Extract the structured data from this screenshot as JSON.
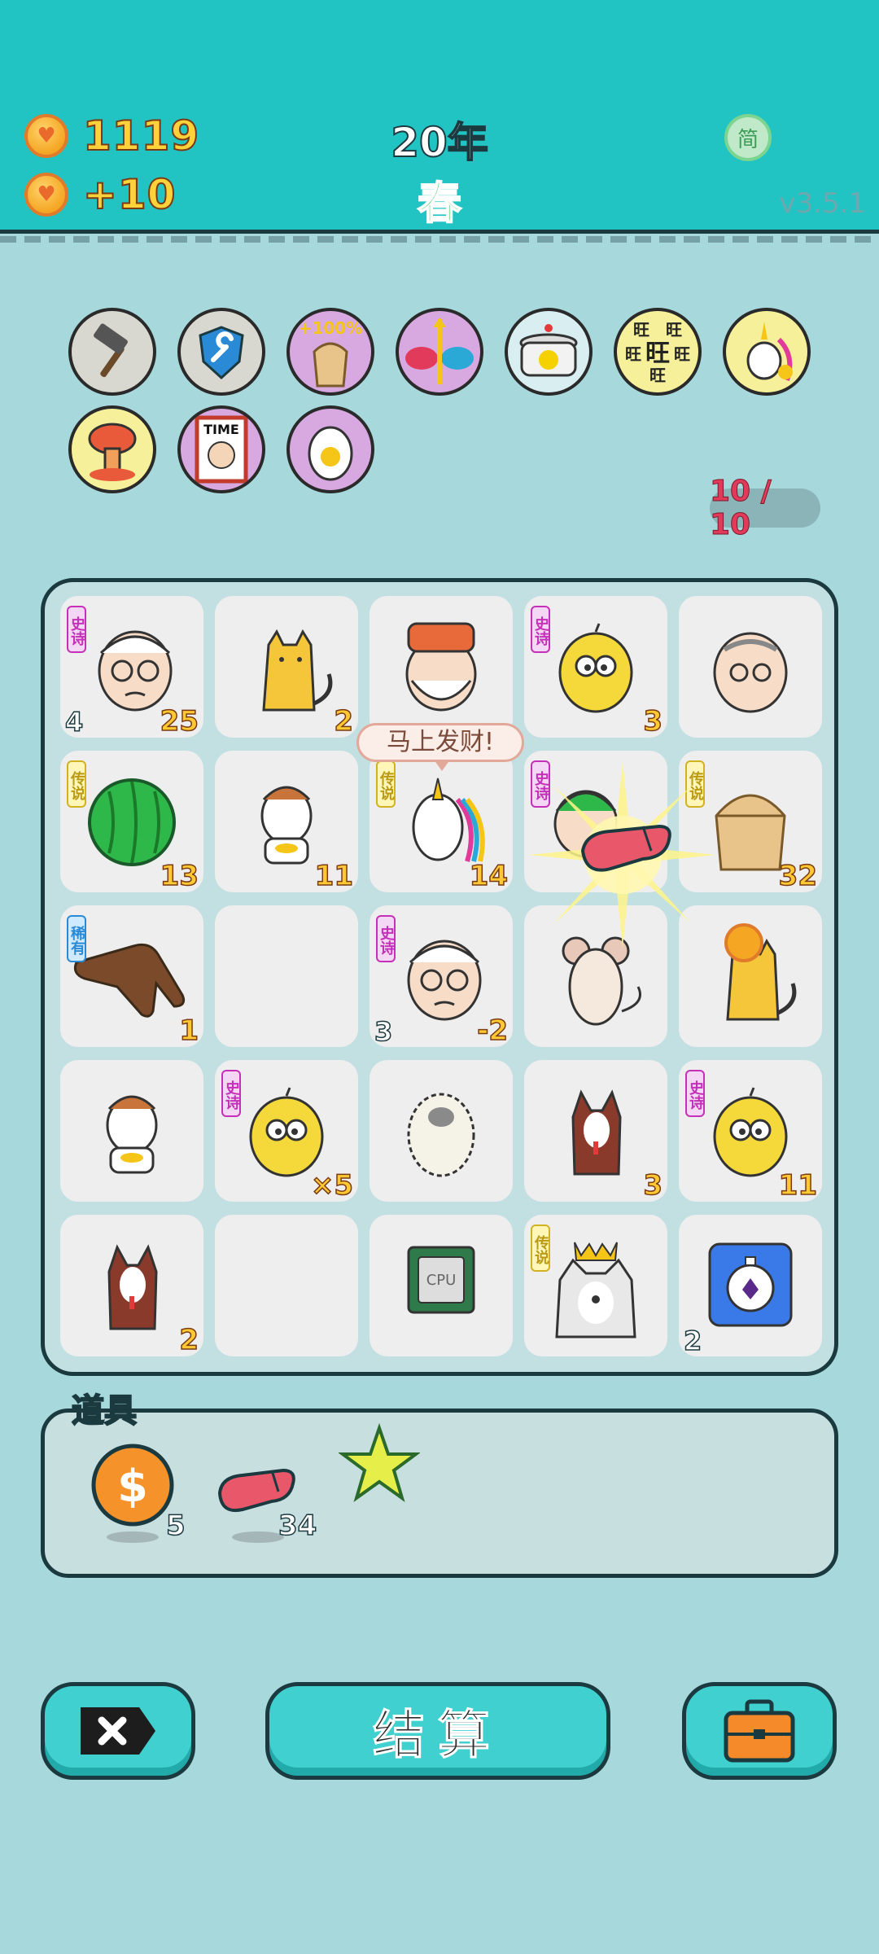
{
  "header": {
    "coins": "1119",
    "income": "+10",
    "year": "20年",
    "season": "春",
    "lang_button": "简",
    "version": "v3.5.1"
  },
  "relics": [
    {
      "name": "hammer-icon",
      "bg": "#d8d8d0"
    },
    {
      "name": "wrench-shield-icon",
      "bg": "#d8d8d0"
    },
    {
      "name": "bubble-tea-icon",
      "bg": "#d8a9e0",
      "label": "+100%"
    },
    {
      "name": "noodle-bowls-icon",
      "bg": "#d8a9e0"
    },
    {
      "name": "rice-cooker-icon",
      "bg": "#d8eef0"
    },
    {
      "name": "wang-text-icon",
      "bg": "#f6f09a",
      "label": "旺"
    },
    {
      "name": "unicorn-icon",
      "bg": "#f6f09a"
    },
    {
      "name": "mushroom-cloud-icon",
      "bg": "#f6f09a"
    },
    {
      "name": "time-magazine-icon",
      "bg": "#d8a9e0",
      "label": "TIME"
    },
    {
      "name": "egg-icon",
      "bg": "#d8a9e0"
    }
  ],
  "relic_counter": "10 / 10",
  "board": {
    "bubble": "马上发财!",
    "cells": [
      {
        "art": "grandpa",
        "tag": "epic",
        "tag_text": "史诗",
        "value": "25",
        "sub": "4"
      },
      {
        "art": "cat",
        "tag": "",
        "tag_text": "",
        "value": "2",
        "sub": ""
      },
      {
        "art": "santa",
        "tag": "",
        "tag_text": "",
        "value": "",
        "sub": ""
      },
      {
        "art": "chick",
        "tag": "epic",
        "tag_text": "史诗",
        "value": "3",
        "sub": ""
      },
      {
        "art": "old-man",
        "tag": "",
        "tag_text": "",
        "value": "",
        "sub": ""
      },
      {
        "art": "watermelon",
        "tag": "legend",
        "tag_text": "传说",
        "value": "13",
        "sub": ""
      },
      {
        "art": "cow",
        "tag": "",
        "tag_text": "",
        "value": "11",
        "sub": ""
      },
      {
        "art": "unicorn",
        "tag": "legend",
        "tag_text": "传说",
        "value": "14",
        "sub": ""
      },
      {
        "art": "green-hair-man",
        "tag": "epic",
        "tag_text": "史诗",
        "value": "",
        "sub": ""
      },
      {
        "art": "bubble-tea",
        "tag": "legend",
        "tag_text": "传说",
        "value": "32",
        "sub": ""
      },
      {
        "art": "pointing-hand",
        "tag": "rare",
        "tag_text": "稀有",
        "value": "1",
        "sub": ""
      },
      {
        "art": "empty",
        "tag": "",
        "tag_text": "",
        "value": "",
        "sub": ""
      },
      {
        "art": "grandpa",
        "tag": "epic",
        "tag_text": "史诗",
        "value": "-2",
        "sub": "3"
      },
      {
        "art": "mouse",
        "tag": "",
        "tag_text": "",
        "value": "",
        "sub": ""
      },
      {
        "art": "cat-coin",
        "tag": "",
        "tag_text": "",
        "value": "",
        "sub": ""
      },
      {
        "art": "cow",
        "tag": "",
        "tag_text": "",
        "value": "",
        "sub": ""
      },
      {
        "art": "chick",
        "tag": "epic",
        "tag_text": "史诗",
        "value": "×5",
        "sub": ""
      },
      {
        "art": "sheep",
        "tag": "",
        "tag_text": "",
        "value": "",
        "sub": ""
      },
      {
        "art": "dog",
        "tag": "",
        "tag_text": "",
        "value": "3",
        "sub": ""
      },
      {
        "art": "chick",
        "tag": "epic",
        "tag_text": "史诗",
        "value": "11",
        "sub": ""
      },
      {
        "art": "dog",
        "tag": "",
        "tag_text": "",
        "value": "2",
        "sub": ""
      },
      {
        "art": "empty",
        "tag": "",
        "tag_text": "",
        "value": "",
        "sub": ""
      },
      {
        "art": "cpu",
        "tag": "",
        "tag_text": "",
        "value": "",
        "sub": "",
        "label": "CPU"
      },
      {
        "art": "king-husky",
        "tag": "legend",
        "tag_text": "传说",
        "value": "",
        "sub": ""
      },
      {
        "art": "stopwatch",
        "tag": "",
        "tag_text": "",
        "value": "",
        "sub": "2"
      }
    ]
  },
  "items": {
    "label": "道具",
    "list": [
      {
        "name": "coin-icon",
        "count": "5"
      },
      {
        "name": "liver-icon",
        "count": "34"
      },
      {
        "name": "star-icon",
        "count": ""
      }
    ]
  },
  "buttons": {
    "settle": "结算"
  }
}
